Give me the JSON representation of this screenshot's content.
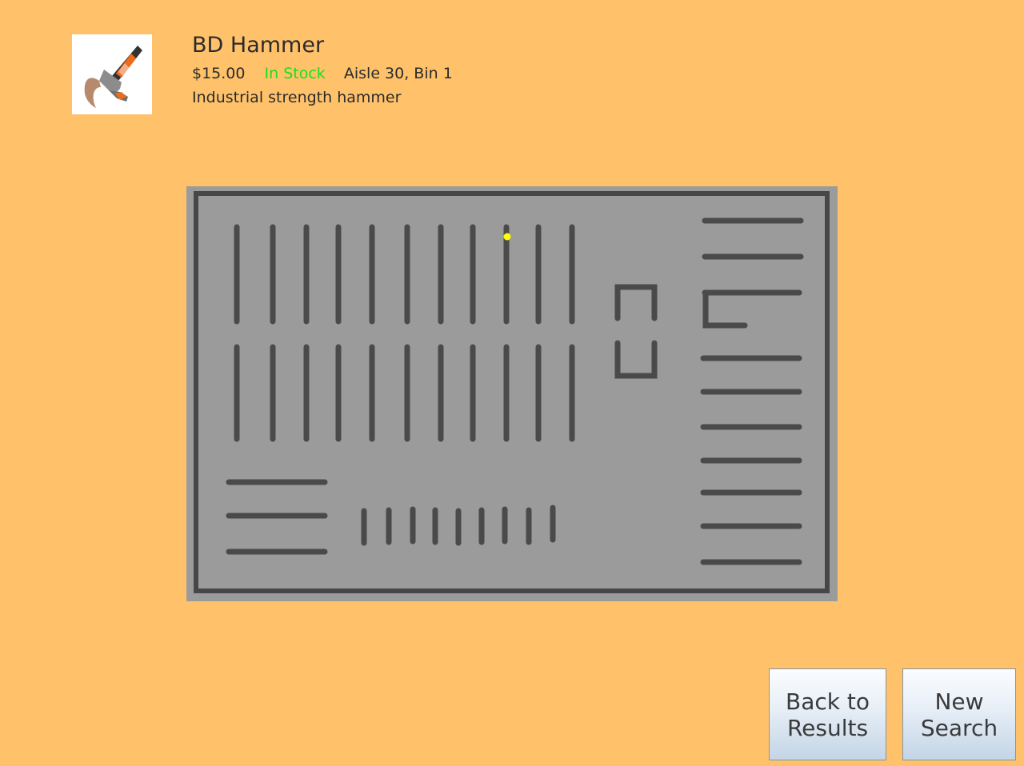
{
  "product": {
    "title": "BD Hammer",
    "price": "$15.00",
    "stock_status": "In Stock",
    "location": "Aisle 30, Bin 1",
    "description": "Industrial strength hammer",
    "image_icon": "hammer-icon"
  },
  "map": {
    "marker_icon": "location-marker-icon",
    "marker_color": "#ffff00"
  },
  "buttons": {
    "back_label": "Back to\nResults",
    "new_search_label": "New\nSearch"
  },
  "colors": {
    "background": "#FFC26A",
    "stock_green": "#19e019",
    "map_floor": "#9b9b9b",
    "shelf": "#4a4a4a"
  }
}
